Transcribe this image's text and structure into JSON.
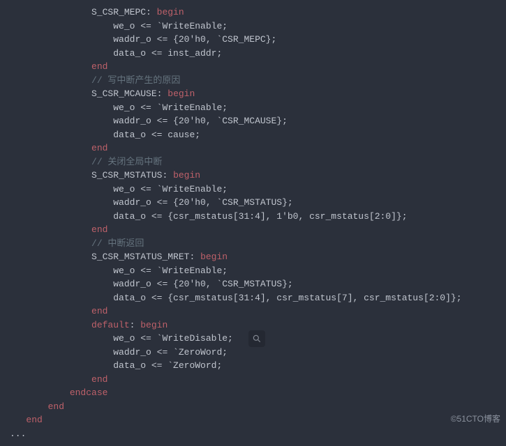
{
  "code": {
    "case1_label": "S_CSR_MEPC",
    "begin": "begin",
    "end": "end",
    "we_assign": "we_o <= `WriteEnable;",
    "waddr_mepc": "waddr_o <= {20'h0, `CSR_MEPC};",
    "data_inst": "data_o <= inst_addr;",
    "cmt1": "// 写中断产生的原因",
    "case2_label": "S_CSR_MCAUSE",
    "waddr_mcause": "waddr_o <= {20'h0, `CSR_MCAUSE};",
    "data_cause": "data_o <= cause;",
    "cmt2": "// 关闭全局中断",
    "case3_label": "S_CSR_MSTATUS",
    "waddr_mstatus": "waddr_o <= {20'h0, `CSR_MSTATUS};",
    "data_mstatus": "data_o <= {csr_mstatus[31:4], 1'b0, csr_mstatus[2:0]};",
    "cmt3": "// 中断返回",
    "case4_label": "S_CSR_MSTATUS_MRET",
    "data_mret": "data_o <= {csr_mstatus[31:4], csr_mstatus[7], csr_mstatus[2:0]};",
    "default": "default",
    "we_dis": "we_o <= `WriteDisable;",
    "waddr_zero": "waddr_o <= `ZeroWord;",
    "data_zero": "data_o <= `ZeroWord;",
    "endcase": "endcase",
    "ellipsis": "..."
  },
  "watermark": "©51CTO博客"
}
